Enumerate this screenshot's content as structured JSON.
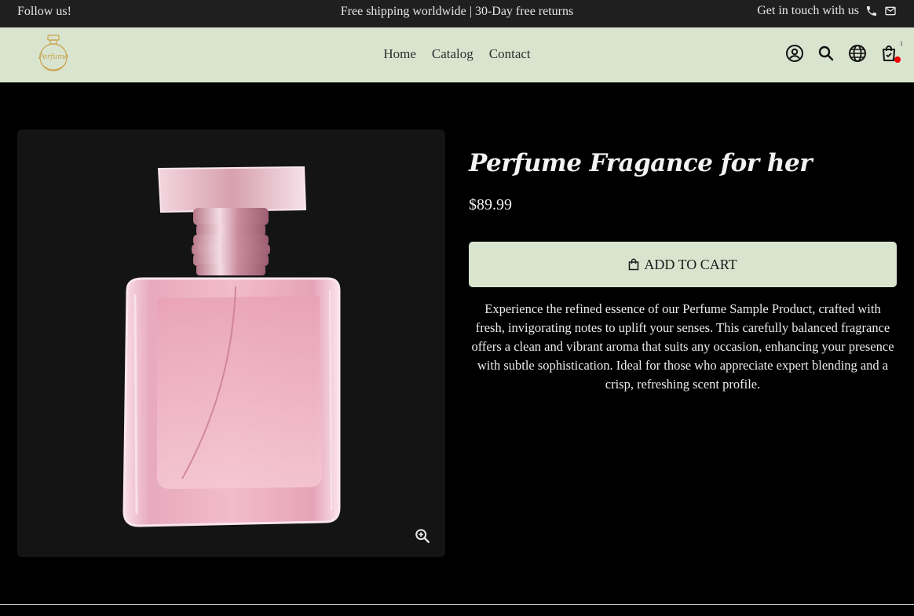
{
  "announcement": {
    "follow_label": "Follow us!",
    "promo": "Free shipping worldwide | 30-Day free returns",
    "contact_label": "Get in touch with us",
    "icons": [
      "phone-icon",
      "mail-icon"
    ]
  },
  "header": {
    "logo_text": "Perfume",
    "nav": [
      "Home",
      "Catalog",
      "Contact"
    ],
    "icons": [
      "account-icon",
      "search-icon",
      "globe-icon",
      "cart-icon"
    ],
    "cart_count": "1",
    "background_color": "#d9e4cf"
  },
  "product": {
    "title": "Perfume Fragance for her",
    "price": "$89.99",
    "add_to_cart": "ADD TO CART",
    "description": "Experience the refined essence of our Perfume Sample Product, crafted with fresh, invigorating notes to uplift your senses. This carefully balanced fragrance offers a clean and vibrant aroma that suits any occasion, enhancing your presence with subtle sophistication. Ideal for those who appreciate expert blending and a crisp, refreshing scent profile."
  }
}
